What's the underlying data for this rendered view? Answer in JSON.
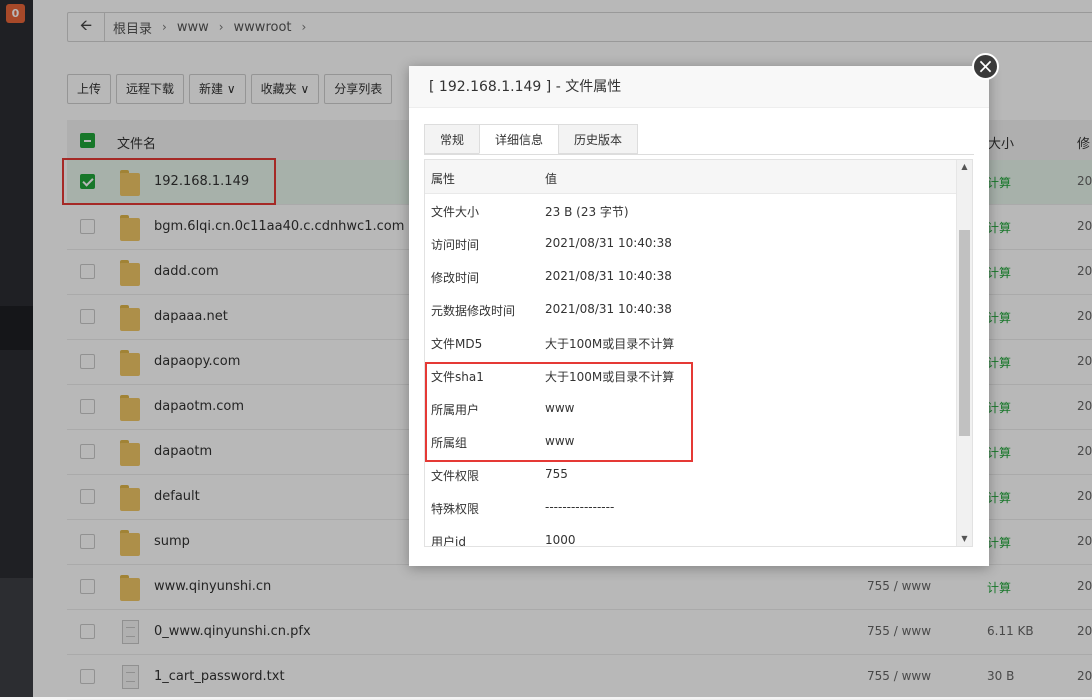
{
  "sidebar": {
    "badge": "0"
  },
  "breadcrumb": {
    "back_icon": "arrow-left-icon",
    "segments": [
      "根目录",
      "www",
      "wwwroot"
    ]
  },
  "toolbar": {
    "upload": "上传",
    "remote_download": "远程下载",
    "new": "新建",
    "favorites": "收藏夹",
    "share_list": "分享列表"
  },
  "table": {
    "headers": {
      "name": "文件名",
      "size": "大小",
      "modified": "修"
    },
    "rows": [
      {
        "name": "192.168.1.149",
        "type": "folder",
        "perm": "",
        "size": "计算",
        "mod": "20",
        "selected": true
      },
      {
        "name": "bgm.6lqi.cn.0c11aa40.c.cdnhwc1.com",
        "type": "folder",
        "perm": "",
        "size": "计算",
        "mod": "20"
      },
      {
        "name": "dadd.com",
        "type": "folder",
        "perm": "",
        "size": "计算",
        "mod": "20"
      },
      {
        "name": "dapaaa.net",
        "type": "folder",
        "perm": "",
        "size": "计算",
        "mod": "20"
      },
      {
        "name": "dapaopy.com",
        "type": "folder",
        "perm": "",
        "size": "计算",
        "mod": "20"
      },
      {
        "name": "dapaotm.com",
        "type": "folder",
        "perm": "",
        "size": "计算",
        "mod": "20"
      },
      {
        "name": "dapaotm",
        "type": "folder",
        "perm": "",
        "size": "计算",
        "mod": "20"
      },
      {
        "name": "default",
        "type": "folder",
        "perm": "",
        "size": "计算",
        "mod": "20"
      },
      {
        "name": "sump",
        "type": "folder",
        "perm": "",
        "size": "计算",
        "mod": "20"
      },
      {
        "name": "www.qinyunshi.cn",
        "type": "folder",
        "perm": "755 / www",
        "size": "计算",
        "mod": "20"
      },
      {
        "name": "0_www.qinyunshi.cn.pfx",
        "type": "file",
        "perm": "755 / www",
        "size": "6.11 KB",
        "mod": "20"
      },
      {
        "name": "1_cart_password.txt",
        "type": "file",
        "perm": "755 / www",
        "size": "30 B",
        "mod": "20"
      }
    ]
  },
  "modal": {
    "title": "[ 192.168.1.149 ] - 文件属性",
    "close_icon": "close-icon",
    "tabs": [
      "常规",
      "详细信息",
      "历史版本"
    ],
    "active_tab": 1,
    "columns": {
      "key": "属性",
      "value": "值"
    },
    "properties": [
      {
        "k": "文件大小",
        "v": "23 B (23 字节)"
      },
      {
        "k": "访问时间",
        "v": "2021/08/31 10:40:38"
      },
      {
        "k": "修改时间",
        "v": "2021/08/31 10:40:38"
      },
      {
        "k": "元数据修改时间",
        "v": "2021/08/31 10:40:38"
      },
      {
        "k": "文件MD5",
        "v": "大于100M或目录不计算"
      },
      {
        "k": "文件sha1",
        "v": "大于100M或目录不计算"
      },
      {
        "k": "所属用户",
        "v": "www"
      },
      {
        "k": "所属组",
        "v": "www"
      },
      {
        "k": "文件权限",
        "v": "755"
      },
      {
        "k": "特殊权限",
        "v": "----------------"
      },
      {
        "k": "用户id",
        "v": "1000"
      }
    ]
  },
  "colors": {
    "accent_green": "#20a53a",
    "highlight_red": "#e53935",
    "badge_orange": "#e8663a"
  }
}
